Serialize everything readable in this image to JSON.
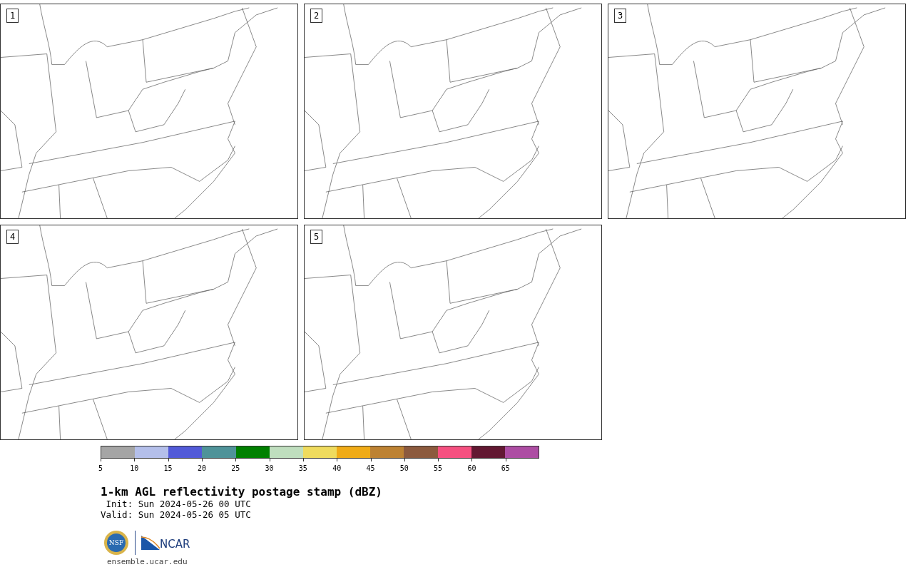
{
  "panels": [
    {
      "number": "1"
    },
    {
      "number": "2"
    },
    {
      "number": "3"
    },
    {
      "number": "4"
    },
    {
      "number": "5"
    }
  ],
  "colorbar": {
    "bins": [
      {
        "label": "5",
        "color": "#a5a5a5"
      },
      {
        "label": "10",
        "color": "#b4bfea"
      },
      {
        "label": "15",
        "color": "#525ad8"
      },
      {
        "label": "20",
        "color": "#4f9399"
      },
      {
        "label": "25",
        "color": "#008000"
      },
      {
        "label": "30",
        "color": "#bfdebe"
      },
      {
        "label": "35",
        "color": "#efdb5e"
      },
      {
        "label": "40",
        "color": "#f0ab17"
      },
      {
        "label": "45",
        "color": "#bd8233"
      },
      {
        "label": "50",
        "color": "#8c5a3e"
      },
      {
        "label": "55",
        "color": "#f55080"
      },
      {
        "label": "60",
        "color": "#621832"
      },
      {
        "label": "65",
        "color": "#ad4da3"
      }
    ]
  },
  "title": "1-km AGL reflectivity postage stamp (dBZ)",
  "init": " Init: Sun 2024-05-26 00 UTC",
  "valid": "Valid: Sun 2024-05-26 05 UTC",
  "logos": {
    "nsf": "NSF",
    "ncar": "NCAR"
  },
  "url": "ensemble.ucar.edu"
}
